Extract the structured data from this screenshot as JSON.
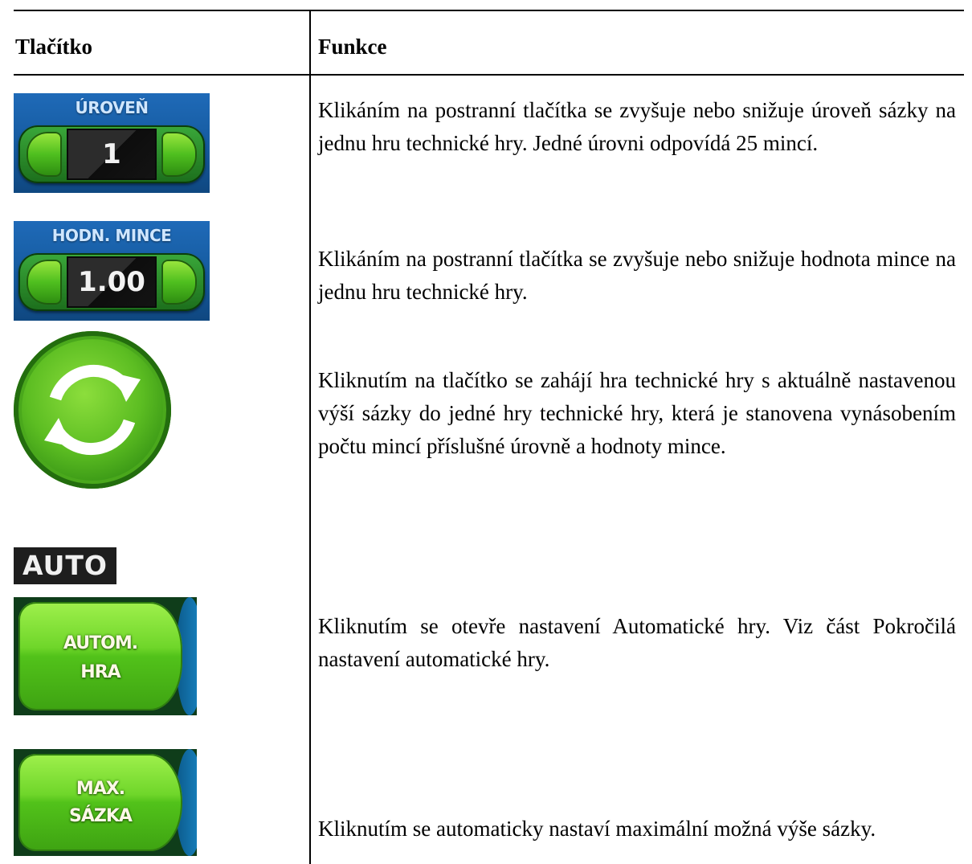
{
  "table": {
    "headers": [
      "Tlačítko",
      "Funkce"
    ],
    "rows": [
      {
        "widget": "stepper",
        "widget_label": "ÚROVEŇ",
        "widget_value": "1",
        "description": "Klikáním na postranní tlačítka se zvyšuje nebo snižuje úroveň sázky na jednu hru technické hry. Jedné úrovni odpovídá 25 mincí."
      },
      {
        "widget": "stepper",
        "widget_label": "HODN. MINCE",
        "widget_value": "1.00",
        "description": "Klikáním na postranní tlačítka se zvyšuje nebo snižuje hodnota mince na jednu hru technické hry."
      },
      {
        "widget": "spin-icon",
        "description": "Kliknutím na tlačítko se zahájí hra technické hry s aktuálně nastavenou výší sázky do jedné hry technické hry, která je stanovena vynásobením počtu mincí příslušné úrovně a hodnoty mince."
      },
      {
        "widget": "auto-buttons",
        "widget_tag": "AUTO",
        "widget_label_lines": [
          "AUTOM.",
          "HRA"
        ],
        "description": "Kliknutím se otevře nastavení Automatické hry. Viz část Pokročilá nastavení automatické hry."
      },
      {
        "widget": "max-bet-button",
        "widget_label_lines": [
          "MAX.",
          "SÁZKA"
        ],
        "description": "Kliknutím se automaticky nastaví maximální možná výše sázky."
      }
    ]
  },
  "colors": {
    "panel_blue": "#155a9e",
    "button_green": "#5cbd22",
    "value_dark": "#1a1a1a"
  }
}
